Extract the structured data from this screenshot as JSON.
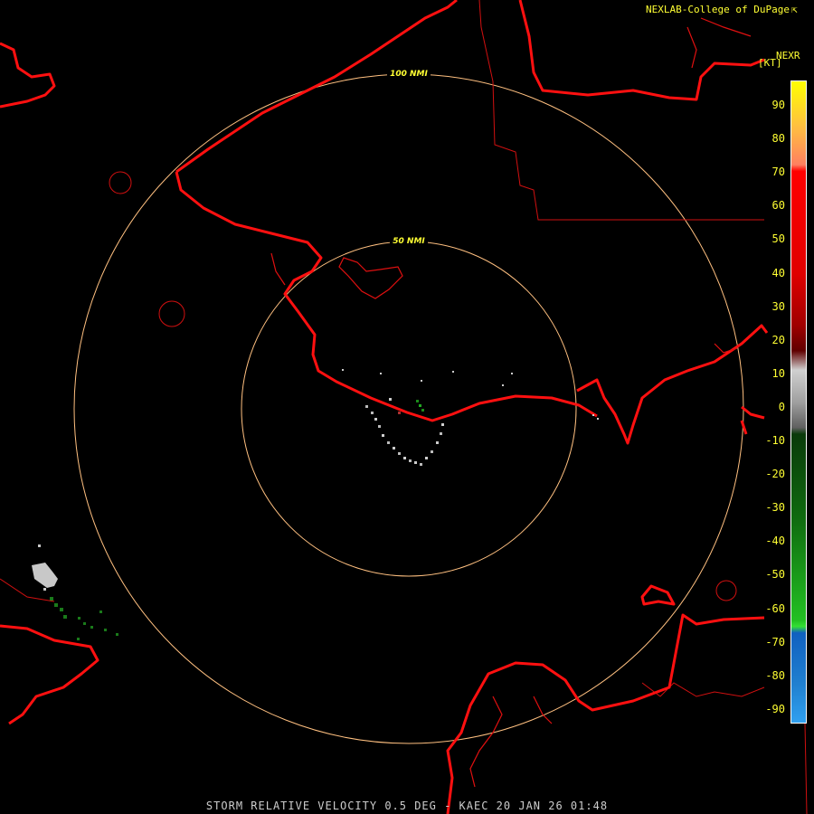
{
  "credit": {
    "text": "NEXLAB-College of DuPage",
    "link_icon": "external-link-icon"
  },
  "colorbar": {
    "product_label": "NEXR",
    "units": "[KT]",
    "ticks": [
      "90",
      "80",
      "70",
      "60",
      "50",
      "40",
      "30",
      "20",
      "10",
      "0",
      "-10",
      "-20",
      "-30",
      "-40",
      "-50",
      "-60",
      "-70",
      "-80",
      "-90"
    ]
  },
  "rings": {
    "inner": "50 NMI",
    "outer": "100 NMI"
  },
  "footer": "STORM RELATIVE VELOCITY 0.5 DEG - KAEC 20 JAN 26 01:48",
  "colors": {
    "coast": "#ff1010",
    "ring": "#ffc080",
    "label": "#ffff33",
    "footer": "#cccccc"
  }
}
